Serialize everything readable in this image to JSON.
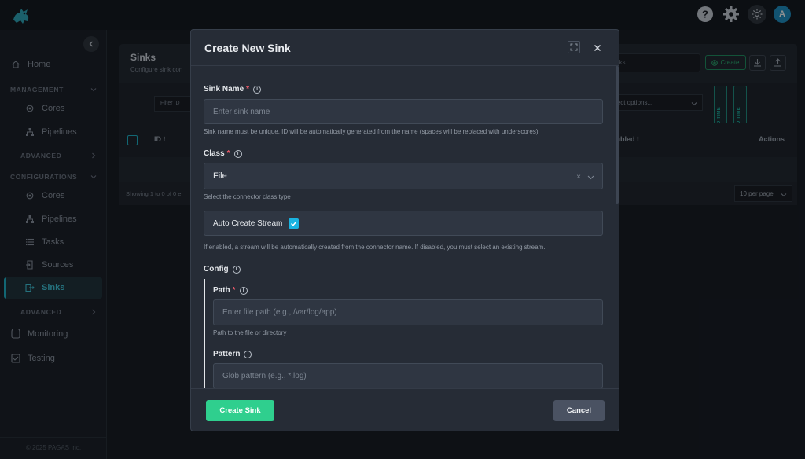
{
  "topbar": {
    "avatar_initial": "A"
  },
  "sidebar": {
    "home": "Home",
    "management_section": "MANAGEMENT",
    "management_items": [
      "Cores",
      "Pipelines"
    ],
    "advanced_1": "ADVANCED",
    "configurations_section": "CONFIGURATIONS",
    "config_items": [
      "Cores",
      "Pipelines",
      "Tasks",
      "Sources",
      "Sinks"
    ],
    "advanced_2": "ADVANCED",
    "monitoring": "Monitoring",
    "testing": "Testing",
    "copyright": "© 2025 PAGAS Inc."
  },
  "background": {
    "page_title": "Sinks",
    "page_subtitle": "Configure sink con",
    "search_placeholder": "nks...",
    "create_label": "Create",
    "filter_id_placeholder": "Filter ID",
    "select_options": "lect options...",
    "col_id": "ID",
    "col_enabled": "abled",
    "col_created_time": "CREATED TIME",
    "col_updated_time": "UPDATED TIME",
    "col_actions": "Actions",
    "showing": "Showing 1 to 0 of 0 e",
    "per_page": "10 per page"
  },
  "modal": {
    "title": "Create New Sink",
    "sink_name": {
      "label": "Sink Name",
      "required": "*",
      "placeholder": "Enter sink name",
      "help": "Sink name must be unique. ID will be automatically generated from the name (spaces will be replaced with underscores)."
    },
    "class": {
      "label": "Class",
      "required": "*",
      "value": "File",
      "help": "Select the connector class type"
    },
    "auto_create": {
      "label": "Auto Create Stream",
      "checked": true,
      "help": "If enabled, a stream will be automatically created from the connector name. If disabled, you must select an existing stream."
    },
    "config": {
      "label": "Config",
      "path": {
        "label": "Path",
        "required": "*",
        "placeholder": "Enter file path (e.g., /var/log/app)",
        "help": "Path to the file or directory"
      },
      "pattern": {
        "label": "Pattern",
        "placeholder": "Glob pattern (e.g., *.log)"
      }
    },
    "create_button": "Create Sink",
    "cancel_button": "Cancel"
  },
  "colors": {
    "accent": "#1ab3c8",
    "primary_button": "#2fcf8e",
    "required": "#ef5b6b"
  }
}
